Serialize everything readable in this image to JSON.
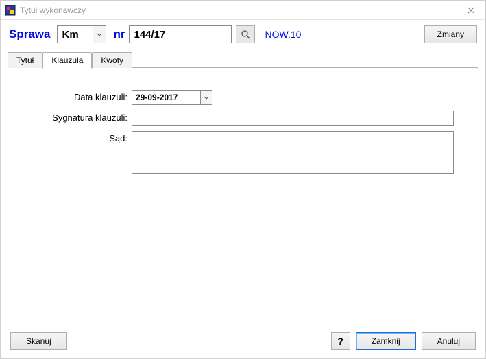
{
  "window": {
    "title": "Tytuł wykonawczy"
  },
  "top": {
    "sprawa_label": "Sprawa",
    "km_value": "Km",
    "nr_label": "nr",
    "nr_value": "144/17",
    "now_label": "NOW.10",
    "zmiany_label": "Zmiany"
  },
  "tabs": {
    "items": [
      {
        "label": "Tytuł"
      },
      {
        "label": "Klauzula"
      },
      {
        "label": "Kwoty"
      }
    ],
    "active_index": 1
  },
  "form": {
    "date_label": "Data klauzuli:",
    "date_value": "29-09-2017",
    "syg_label": "Sygnatura klauzuli:",
    "syg_value": "",
    "sad_label": "Sąd:",
    "sad_value": ""
  },
  "bottom": {
    "skanuj_label": "Skanuj",
    "help_label": "?",
    "zamknij_label": "Zamknij",
    "anuluj_label": "Anuluj"
  }
}
